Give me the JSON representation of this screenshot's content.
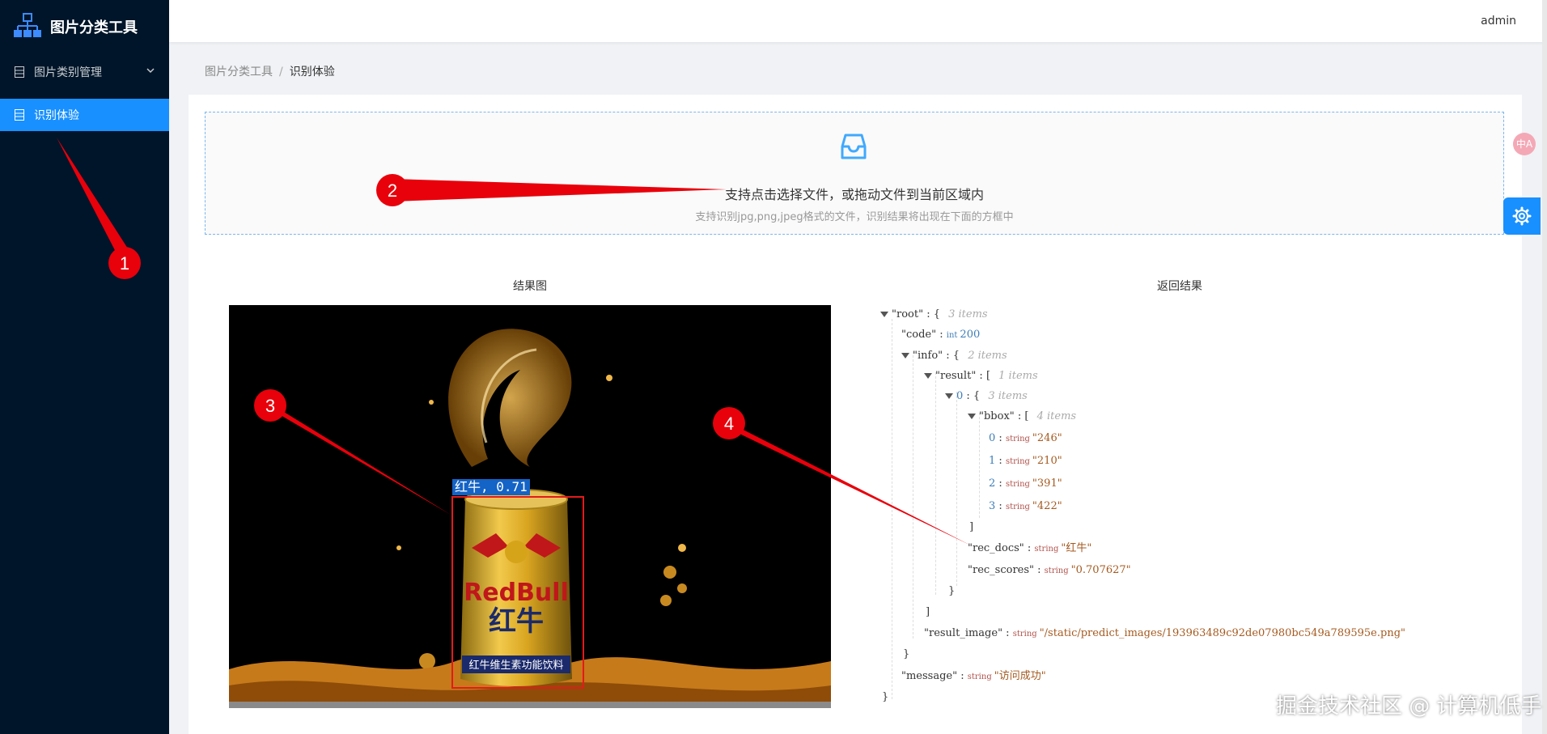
{
  "app": {
    "title": "图片分类工具",
    "user": "admin"
  },
  "sidebar": {
    "items": [
      {
        "label": "图片类别管理",
        "icon": "list-icon",
        "expandable": true
      },
      {
        "label": "识别体验",
        "icon": "list-icon",
        "active": true
      }
    ]
  },
  "breadcrumb": {
    "root": "图片分类工具",
    "separator": "/",
    "current": "识别体验"
  },
  "upload": {
    "text": "支持点击选择文件，或拖动文件到当前区域内",
    "hint": "支持识别jpg,png,jpeg格式的文件，识别结果将出现在下面的方框中"
  },
  "result_image": {
    "title": "结果图",
    "detection_label": "红牛, 0.71"
  },
  "result_json": {
    "title": "返回结果",
    "lines": {
      "root_key": "\"root\"",
      "root_count": "3 items",
      "code_key": "\"code\"",
      "code_type": "int",
      "code_value": "200",
      "info_key": "\"info\"",
      "info_count": "2 items",
      "result_key": "\"result\"",
      "result_count": "1 items",
      "idx0_key": "0",
      "idx0_count": "3 items",
      "bbox_key": "\"bbox\"",
      "bbox_count": "4 items",
      "bbox": [
        {
          "idx": "0",
          "type": "string",
          "value": "\"246\""
        },
        {
          "idx": "1",
          "type": "string",
          "value": "\"210\""
        },
        {
          "idx": "2",
          "type": "string",
          "value": "\"391\""
        },
        {
          "idx": "3",
          "type": "string",
          "value": "\"422\""
        }
      ],
      "rec_docs_key": "\"rec_docs\"",
      "rec_docs_type": "string",
      "rec_docs_value": "\"红牛\"",
      "rec_scores_key": "\"rec_scores\"",
      "rec_scores_type": "string",
      "rec_scores_value": "\"0.707627\"",
      "result_image_key": "\"result_image\"",
      "result_image_type": "string",
      "result_image_value": "\"/static/predict_images/193963489c92de07980bc549a789595e.png\"",
      "message_key": "\"message\"",
      "message_type": "string",
      "message_value": "\"访问成功\""
    }
  },
  "annotations": [
    "1",
    "2",
    "3",
    "4"
  ],
  "float_badge": "中A",
  "watermark": "掘金技术社区 @ 计算机低手",
  "colors": {
    "sidebar": "#001529",
    "accent": "#1890ff",
    "annotation": "#e8000b"
  }
}
